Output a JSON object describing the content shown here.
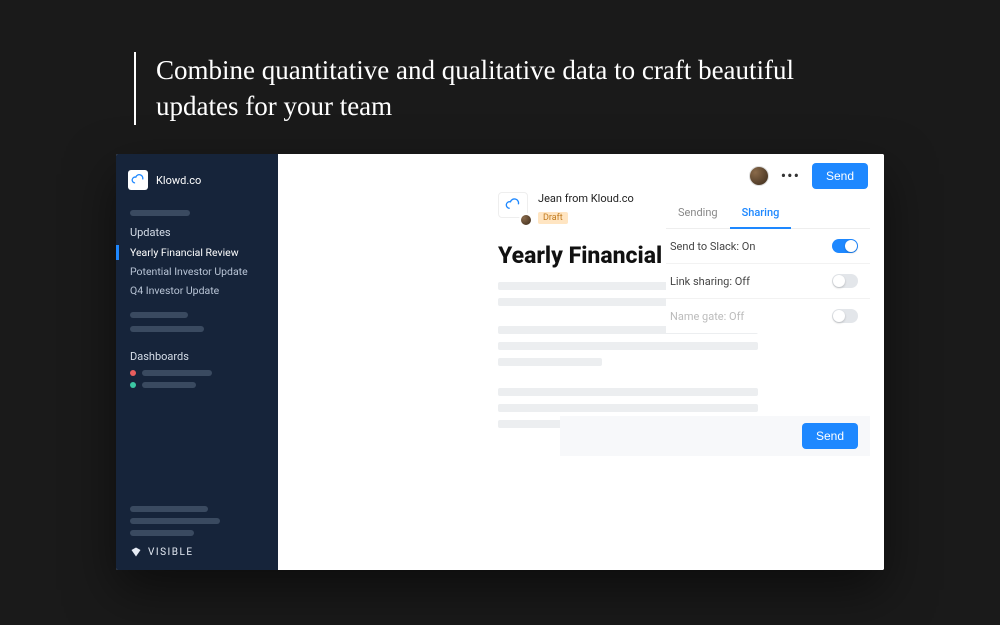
{
  "hero": "Combine quantitative and qualitative data to craft beautiful updates for your team",
  "sidebar": {
    "brand": "Klowd.co",
    "updates_label": "Updates",
    "updates": [
      {
        "label": "Yearly Financial Review",
        "active": true
      },
      {
        "label": "Potential Investor Update",
        "active": false
      },
      {
        "label": "Q4 Investor Update",
        "active": false
      }
    ],
    "dashboards_label": "Dashboards",
    "footer_brand": "VISIBLE"
  },
  "topbar": {
    "send_label": "Send"
  },
  "document": {
    "author": "Jean from Kloud.co",
    "status_badge": "Draft",
    "title": "Yearly Financial Review"
  },
  "share": {
    "tabs": {
      "sending": "Sending",
      "sharing": "Sharing"
    },
    "rows": {
      "slack": "Send to Slack: On",
      "link": "Link sharing: Off",
      "name_gate": "Name gate: Off"
    },
    "send_label": "Send"
  }
}
